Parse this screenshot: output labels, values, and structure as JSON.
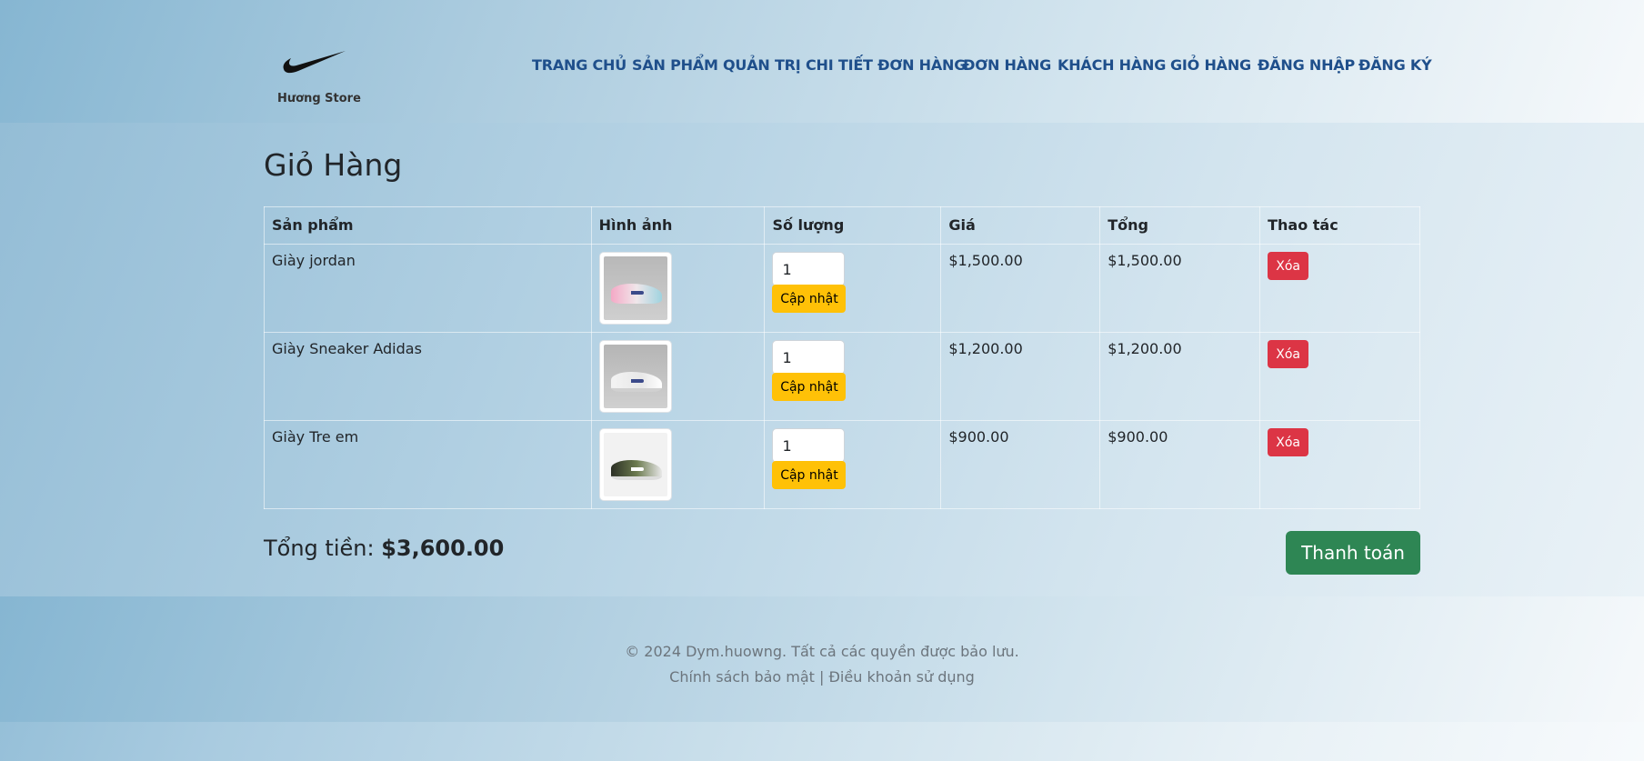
{
  "brand": {
    "name": "Hương Store",
    "logo": "nike-swoosh-logo"
  },
  "nav": [
    {
      "label": "TRANG CHỦ"
    },
    {
      "label": "SẢN PHẨM"
    },
    {
      "label": "QUẢN TRỊ"
    },
    {
      "label": "CHI TIẾT ĐƠN HÀNG"
    },
    {
      "label": "ĐƠN HÀNG"
    },
    {
      "label": "KHÁCH HÀNG"
    },
    {
      "label": "GIỎ HÀNG"
    },
    {
      "label": "ĐĂNG NHẬP"
    },
    {
      "label": "ĐĂNG KÝ"
    }
  ],
  "page_title": "Giỏ Hàng",
  "table": {
    "headers": [
      "Sản phẩm",
      "Hình ảnh",
      "Số lượng",
      "Giá",
      "Tổng",
      "Thao tác"
    ],
    "rows": [
      {
        "name": "Giày jordan",
        "image": "sneaker-pink-image",
        "qty": "1",
        "update_label": "Cập nhật",
        "price": "$1,500.00",
        "total": "$1,500.00",
        "delete_label": "Xóa"
      },
      {
        "name": "Giày Sneaker Adidas",
        "image": "sneaker-white-image",
        "qty": "1",
        "update_label": "Cập nhật",
        "price": "$1,200.00",
        "total": "$1,200.00",
        "delete_label": "Xóa"
      },
      {
        "name": "Giày Tre em",
        "image": "sneaker-green-image",
        "qty": "1",
        "update_label": "Cập nhật",
        "price": "$900.00",
        "total": "$900.00",
        "delete_label": "Xóa"
      }
    ]
  },
  "summary": {
    "label": "Tổng tiền:",
    "amount": "$3,600.00",
    "checkout_label": "Thanh toán"
  },
  "footer": {
    "copyright": "© 2024 Dym.huowng. Tất cả các quyền được bảo lưu.",
    "privacy": "Chính sách bảo mật",
    "separator": "|",
    "terms": "Điều khoản sử dụng"
  },
  "colors": {
    "update": "#ffc107",
    "delete": "#dc3545",
    "checkout": "#2e8654",
    "nav": "#1f4f8b"
  }
}
